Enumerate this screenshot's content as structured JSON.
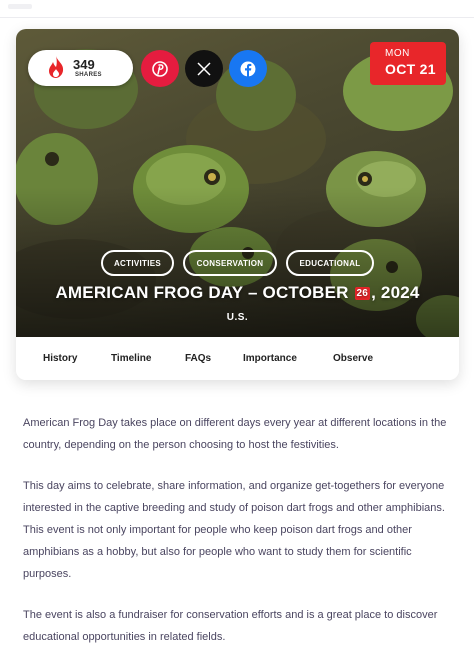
{
  "shares": {
    "count": "349",
    "label": "SHARES",
    "icon": "fire-icon"
  },
  "social": [
    {
      "name": "pinterest",
      "glyph": "P",
      "color": "#e51c3f"
    },
    {
      "name": "x",
      "glyph": "X",
      "color": "#111111"
    },
    {
      "name": "facebook",
      "glyph": "f",
      "color": "#1877f2"
    }
  ],
  "date": {
    "weekday": "MON",
    "day": "OCT 21",
    "accent": "#e8262a"
  },
  "tags": [
    "ACTIVITIES",
    "CONSERVATION",
    "EDUCATIONAL"
  ],
  "title": {
    "before": "AMERICAN FROG DAY – OCTOBER ",
    "day_icon": "26",
    "after": ", 2024"
  },
  "country": "U.S.",
  "tabs": [
    "History",
    "Timeline",
    "FAQs",
    "Importance",
    "Observe"
  ],
  "article": [
    "American Frog Day takes place on different days every year at different locations in the country, depending on the person choosing to host the festivities.",
    "This day aims to celebrate, share information, and organize get-togethers for everyone interested in the captive breeding and study of poison dart frogs and other amphibians. This event is not only important for people who keep poison dart frogs and other amphibians as a hobby, but also for people who want to study them for scientific purposes.",
    "The event is also a fundraiser for conservation efforts and is a great place to discover educational opportunities in related fields."
  ]
}
